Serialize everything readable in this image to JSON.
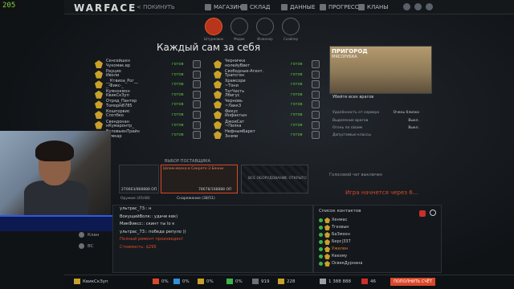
{
  "fps": "205",
  "topbar": {
    "logo": "WARFACE",
    "back": "< ПОКИНУТЬ",
    "nav": [
      "МАГАЗИН",
      "СКЛАД",
      "ДАННЫЕ",
      "ПРОГРЕСС",
      "КЛАНЫ"
    ]
  },
  "modes": [
    "Штурмовик",
    "Медик",
    "Инженер",
    "Снайпер"
  ],
  "title": "Каждый сам за себя",
  "team_a": [
    {
      "name": "Сенсейшен\nЧукомак.вр",
      "status": "готов"
    },
    {
      "name": "Рауцио\nИволи",
      "status": "готов"
    },
    {
      "name": "__Ктвиоа_Рог__\n_-Фикс-_",
      "status": "готов"
    },
    {
      "name": "Кумнокмон\nКвикСкЗуп",
      "status": "готов"
    },
    {
      "name": "Отряд_Пантер\nТоморм8785",
      "status": "готов"
    },
    {
      "name": "Кошпорвис\nСпотбко",
      "status": "готов"
    },
    {
      "name": "Свендонан\nнКумаронтр_",
      "status": "готов"
    },
    {
      "name": "ВаловыянТрайн\nКумкар",
      "status": "готов"
    }
  ],
  "team_b": [
    {
      "name": "Черничка\nнолейуВвет",
      "status": "готов"
    },
    {
      "name": "Свободные-Агент.\nТрапсген",
      "status": "готов"
    },
    {
      "name": "Храмсори\n~Тони",
      "status": "готов"
    },
    {
      "name": "ТатЧесть\nЛбигус",
      "status": "готов"
    },
    {
      "name": "Черновь\n~Лакк3",
      "status": "готов"
    },
    {
      "name": "Фикус\nИнфактын",
      "status": "готов"
    },
    {
      "name": "ДжоиСат\n~Пилка",
      "status": "готов"
    },
    {
      "name": "НефнымБарет\nЗнзми",
      "status": "готов"
    }
  ],
  "map": {
    "name": "ПРИГОРОД",
    "sub": "МЯСОРУБКА",
    "objective": "Убейте всех врагов"
  },
  "settings": [
    {
      "label": "Удалённость от сервера",
      "value": "Очень близко"
    },
    {
      "label": "Выделение врагов",
      "value": "Выкл."
    },
    {
      "label": "Огонь по своим",
      "value": "Выкл."
    },
    {
      "label": "Допустимые классы",
      "value": ""
    }
  ],
  "voice_chat": "Голосовой чат выключен",
  "start_msg": "Игра начнется через 6...",
  "supply": {
    "header": "ВЫБОР ПОСТАВЩИКА",
    "weapon1": "270663/868888 ОП",
    "weapon2_top": "Шлем-маска в Секрете 3 Бенни",
    "weapon2_bottom": "78678/168888 ОП",
    "weapon3": "ВСЕ ОБОРУДОВАНИЕ ОТКРЫТО",
    "equip_left": "Оружие (45/48)",
    "equip_right": "Снаряжение (38/51)"
  },
  "sidebar": [
    "Клан",
    "ВС"
  ],
  "chat": [
    {
      "text": "ультрас_73:: н",
      "cls": "usr"
    },
    {
      "text": "ВокущийВолк:: удачи квк)",
      "cls": "usr"
    },
    {
      "text": "МикФиксс:: скинт ты lo к",
      "cls": "usr"
    },
    {
      "text": "ультрас_73:: победа репуло ))",
      "cls": "usr"
    },
    {
      "text": "Полный ремонт произведен!",
      "cls": "red"
    },
    {
      "text": "Стоимость: $295",
      "cls": "red"
    }
  ],
  "contacts": {
    "header": "Список контактов",
    "items": [
      {
        "name": "Хенмас",
        "hl": false
      },
      {
        "name": "Тгезвын",
        "hl": false
      },
      {
        "name": "БаЗмоон",
        "hl": false
      },
      {
        "name": "Берс|337",
        "hl": false
      },
      {
        "name": "Ужелен",
        "hl": true
      },
      {
        "name": "Кеезму",
        "hl": false
      },
      {
        "name": "ОсвекДурнана",
        "hl": false
      }
    ]
  },
  "statusbar": {
    "player": "КвикСкЗуп",
    "stats": [
      "0%",
      "0%",
      "0%",
      "0%",
      "919",
      "228"
    ],
    "money": "1 388 888",
    "crowns": "46",
    "supply_btn": "ПОПОЛНИТЬ СЧЁТ"
  },
  "colors": {
    "accent": "#d9482b",
    "ready": "#5bbf3a",
    "gold": "#c9a12a"
  }
}
